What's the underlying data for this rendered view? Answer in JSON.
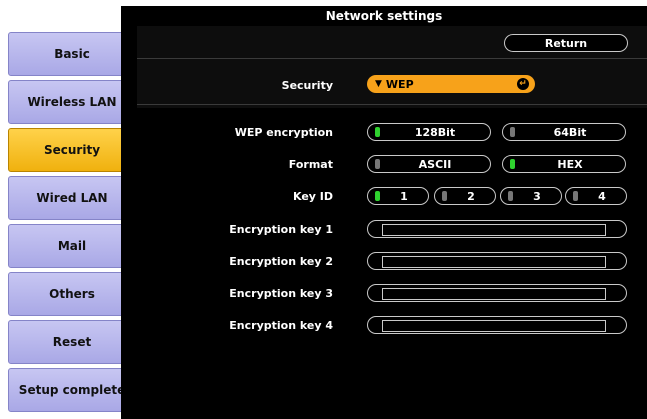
{
  "window": {
    "title": "Network settings"
  },
  "sidebar": {
    "items": [
      {
        "label": "Basic"
      },
      {
        "label": "Wireless LAN"
      },
      {
        "label": "Security"
      },
      {
        "label": "Wired LAN"
      },
      {
        "label": "Mail"
      },
      {
        "label": "Others"
      },
      {
        "label": "Reset"
      },
      {
        "label": "Setup complete"
      }
    ],
    "active": "Security"
  },
  "header": {
    "return_label": "Return"
  },
  "security": {
    "label": "Security",
    "selected": "WEP",
    "dropdown_icon": "triangle-down-icon",
    "enter_icon": "enter-icon"
  },
  "wep_encryption": {
    "label": "WEP encryption",
    "options": [
      "128Bit",
      "64Bit"
    ],
    "selected": "128Bit"
  },
  "format": {
    "label": "Format",
    "options": [
      "ASCII",
      "HEX"
    ],
    "selected": "HEX"
  },
  "key_id": {
    "label": "Key ID",
    "options": [
      "1",
      "2",
      "3",
      "4"
    ],
    "selected": "1"
  },
  "encryption_keys": [
    {
      "label": "Encryption key 1",
      "value": ""
    },
    {
      "label": "Encryption key 2",
      "value": ""
    },
    {
      "label": "Encryption key 3",
      "value": ""
    },
    {
      "label": "Encryption key 4",
      "value": ""
    }
  ],
  "colors": {
    "accent_orange": "#f7a21a",
    "active_tab": "#f0b10e",
    "tab": "#b9b8ec",
    "panel_bg": "#000000",
    "indicator_on": "#2fd22f"
  }
}
